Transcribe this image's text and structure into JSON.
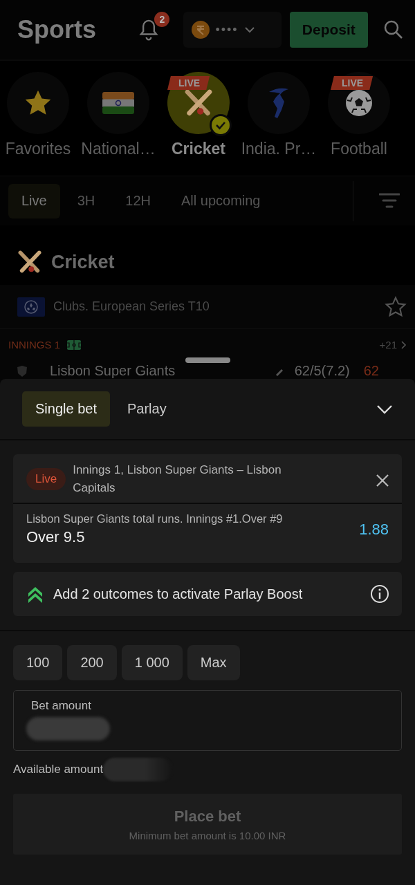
{
  "header": {
    "title": "Sports",
    "notifications": "2",
    "balance": "••••",
    "deposit": "Deposit"
  },
  "sports": [
    {
      "label": "Favorites",
      "kind": "star",
      "selected": false
    },
    {
      "label": "National…",
      "kind": "flag",
      "selected": false
    },
    {
      "label": "Cricket",
      "kind": "cricket",
      "badge": "LIVE",
      "selected": true
    },
    {
      "label": "India. Pr…",
      "kind": "batsman",
      "selected": false
    },
    {
      "label": "Football",
      "kind": "ball",
      "badge": "LIVE",
      "selected": false
    }
  ],
  "time_filters": [
    {
      "label": "Live",
      "selected": true
    },
    {
      "label": "3H",
      "selected": false
    },
    {
      "label": "12H",
      "selected": false
    },
    {
      "label": "All upcoming",
      "selected": false
    }
  ],
  "section": {
    "title": "Cricket"
  },
  "league": {
    "name": "Clubs. European Series T10",
    "favorite": false
  },
  "match": {
    "status": "INNINGS 1",
    "more": "+21",
    "team": "Lisbon Super Giants",
    "score": "62/5(7.2)",
    "score_2": "62"
  },
  "betslip": {
    "tabs": [
      {
        "label": "Single bet",
        "selected": true
      },
      {
        "label": "Parlay",
        "selected": false
      }
    ],
    "bet": {
      "badge": "Live",
      "event": "Innings 1, Lisbon Super Giants – Lisbon Capitals",
      "market": "Lisbon Super Giants total runs. Innings #1.Over #9",
      "selection": "Over 9.5",
      "odds": "1.88"
    },
    "boost": "Add 2 outcomes to activate Parlay Boost",
    "quick_amounts": [
      "100",
      "200",
      "1 000",
      "Max"
    ],
    "amount_field": {
      "label": "Bet amount"
    },
    "available_label": "Available amount",
    "place_bet": {
      "label": "Place bet",
      "note": "Minimum bet amount is 10.00 INR",
      "disabled": true
    }
  }
}
